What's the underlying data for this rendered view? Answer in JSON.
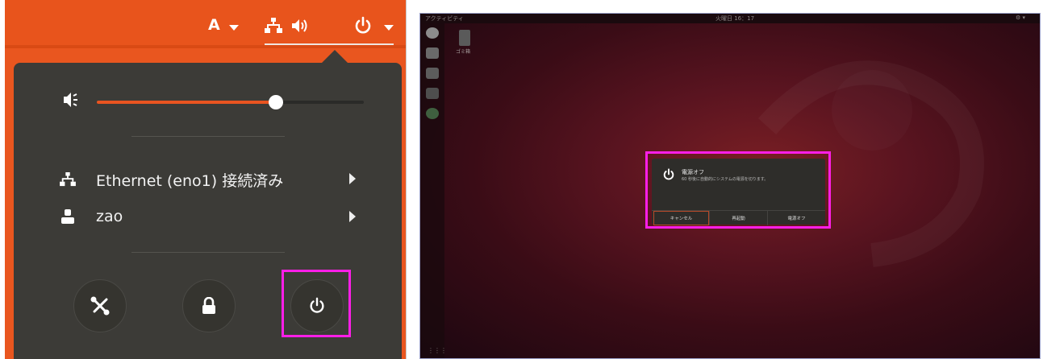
{
  "left_panel": {
    "topbar": {
      "input_method": "A",
      "icons": [
        "network-icon",
        "volume-icon",
        "power-icon",
        "chevron-down-icon"
      ]
    },
    "volume": {
      "level": 0.67
    },
    "network": {
      "label": "Ethernet (eno1) 接続済み"
    },
    "user": {
      "label": "zao"
    },
    "actions": [
      "settings-icon",
      "lock-icon",
      "power-icon"
    ],
    "highlight_color": "#ff1ee8",
    "accent_color": "#e95420"
  },
  "right_panel": {
    "topbar": {
      "activities": "アクティビティ",
      "clock": "火曜日 16：17"
    },
    "desktop_icon_label": "ゴミ箱",
    "dialog": {
      "title": "電源オフ",
      "body": "60 秒後に自動的にシステムの電源を切ります。",
      "buttons": {
        "cancel": "キャンセル",
        "restart": "再起動",
        "power_off": "電源オフ"
      }
    }
  }
}
